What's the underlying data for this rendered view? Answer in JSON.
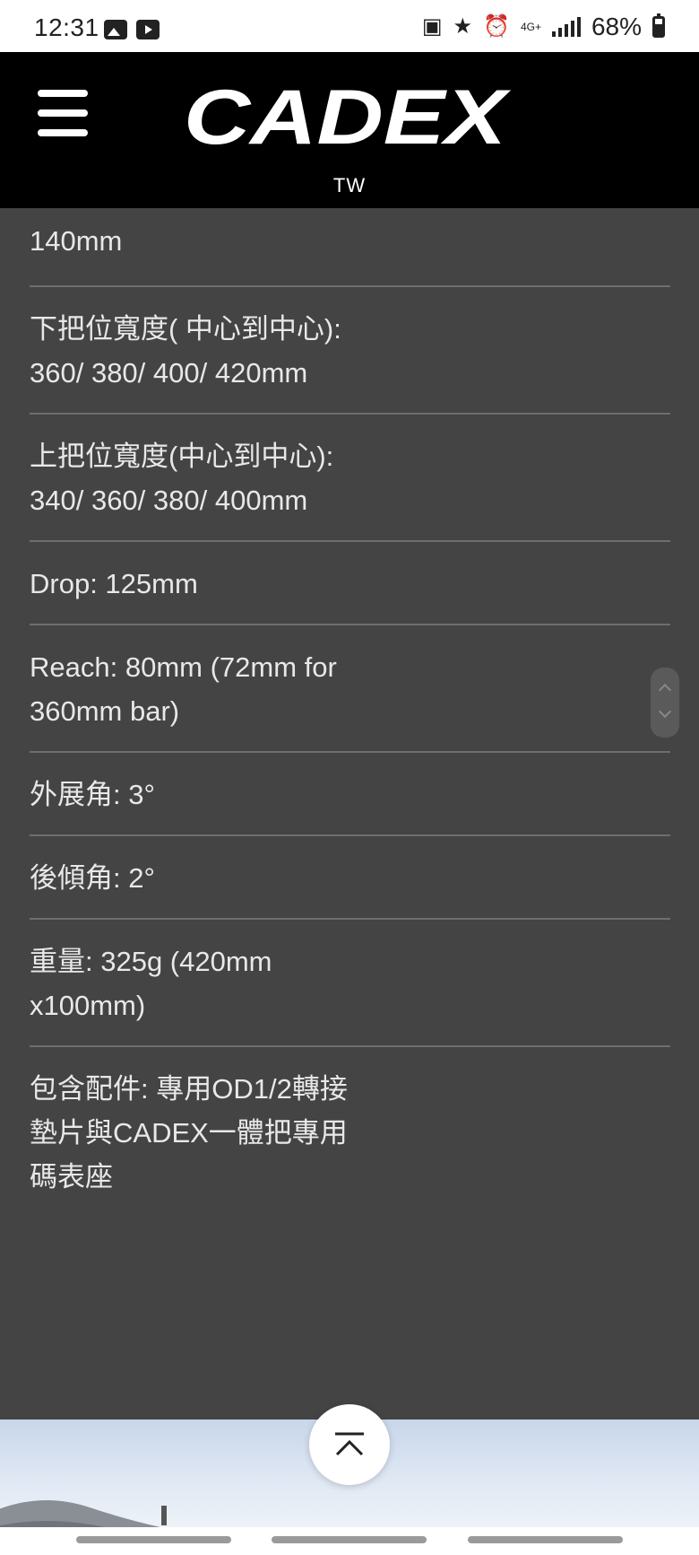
{
  "status_bar": {
    "time": "12:31",
    "battery": "68%",
    "network": "4G+",
    "left_icons": [
      "image-notification-icon",
      "youtube-notification-icon"
    ],
    "right_icons": [
      "nfc-icon",
      "star-icon",
      "alarm-icon",
      "data-icon",
      "signal-icon",
      "battery-icon"
    ]
  },
  "header": {
    "logo_text": "CADEX",
    "region": "TW",
    "menu_icon": "hamburger-icon",
    "background": "#000000"
  },
  "specs": {
    "partial_top": "140mm",
    "items": [
      "下把位寬度( 中心到中心): 360/ 380/ 400/ 420mm",
      "上把位寬度(中心到中心): 340/ 360/ 380/ 400mm",
      "Drop: 125mm",
      "Reach: 80mm (72mm for 360mm bar)",
      "外展角: 3°",
      "後傾角: 2°",
      "重量: 325g (420mm x100mm)",
      "包含配件: 專用OD1/2轉接墊片與CADEX一體把專用碼表座"
    ],
    "background": "#444444",
    "text_color": "#e8e8e8"
  },
  "back_to_top_icon": "chevron-up-icon"
}
